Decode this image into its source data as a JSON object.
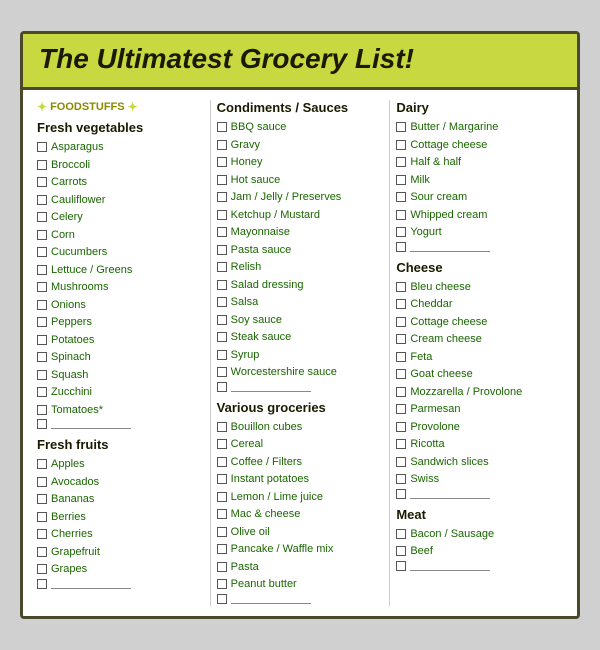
{
  "header": {
    "title": "The Ultimatest Grocery List!"
  },
  "col1": {
    "badge": "✦ FOODSTUFFS ✦",
    "sections": [
      {
        "title": "Fresh vegetables",
        "items": [
          "Asparagus",
          "Broccoli",
          "Carrots",
          "Cauliflower",
          "Celery",
          "Corn",
          "Cucumbers",
          "Lettuce / Greens",
          "Mushrooms",
          "Onions",
          "Peppers",
          "Potatoes",
          "Spinach",
          "Squash",
          "Zucchini",
          "Tomatoes*"
        ]
      },
      {
        "title": "Fresh fruits",
        "items": [
          "Apples",
          "Avocados",
          "Bananas",
          "Berries",
          "Cherries",
          "Grapefruit",
          "Grapes"
        ]
      }
    ]
  },
  "col2": {
    "sections": [
      {
        "title": "Condiments / Sauces",
        "items": [
          "BBQ sauce",
          "Gravy",
          "Honey",
          "Hot sauce",
          "Jam / Jelly / Preserves",
          "Ketchup / Mustard",
          "Mayonnaise",
          "Pasta sauce",
          "Relish",
          "Salad dressing",
          "Salsa",
          "Soy sauce",
          "Steak sauce",
          "Syrup",
          "Worcestershire sauce"
        ]
      },
      {
        "title": "Various groceries",
        "items": [
          "Bouillon cubes",
          "Cereal",
          "Coffee / Filters",
          "Instant potatoes",
          "Lemon / Lime juice",
          "Mac & cheese",
          "Olive oil",
          "Pancake / Waffle mix",
          "Pasta",
          "Peanut butter"
        ]
      }
    ]
  },
  "col3": {
    "sections": [
      {
        "title": "Dairy",
        "items": [
          "Butter / Margarine",
          "Cottage cheese",
          "Half & half",
          "Milk",
          "Sour cream",
          "Whipped cream",
          "Yogurt"
        ]
      },
      {
        "title": "Cheese",
        "items": [
          "Bleu cheese",
          "Cheddar",
          "Cottage cheese",
          "Cream cheese",
          "Feta",
          "Goat cheese",
          "Mozzarella / Provolone",
          "Parmesan",
          "Provolone",
          "Ricotta",
          "Sandwich slices",
          "Swiss"
        ]
      },
      {
        "title": "Meat",
        "items": [
          "Bacon / Sausage",
          "Beef"
        ]
      }
    ]
  }
}
